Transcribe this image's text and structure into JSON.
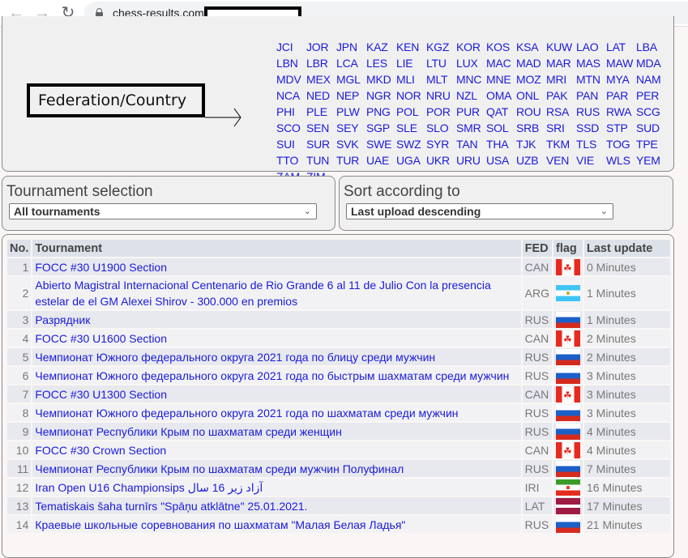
{
  "browser": {
    "url": "chess-results.com/",
    "back_icon": "arrow-left-icon",
    "forward_icon": "arrow-right-icon",
    "reload_icon": "reload-icon"
  },
  "annotation": {
    "label": "Federation/Country"
  },
  "federations": [
    "JCI",
    "JOR",
    "JPN",
    "KAZ",
    "KEN",
    "KGZ",
    "KOR",
    "KOS",
    "KSA",
    "KUW",
    "LAO",
    "LAT",
    "LBA",
    "LBN",
    "LBR",
    "LCA",
    "LES",
    "LIE",
    "LTU",
    "LUX",
    "MAC",
    "MAD",
    "MAR",
    "MAS",
    "MAW",
    "MDA",
    "MDV",
    "MEX",
    "MGL",
    "MKD",
    "MLI",
    "MLT",
    "MNC",
    "MNE",
    "MOZ",
    "MRI",
    "MTN",
    "MYA",
    "NAM",
    "NCA",
    "NED",
    "NEP",
    "NGR",
    "NOR",
    "NRU",
    "NZL",
    "OMA",
    "ONL",
    "PAK",
    "PAN",
    "PAR",
    "PER",
    "PHI",
    "PLE",
    "PLW",
    "PNG",
    "POL",
    "POR",
    "PUR",
    "QAT",
    "ROU",
    "RSA",
    "RUS",
    "RWA",
    "SCG",
    "SCO",
    "SEN",
    "SEY",
    "SGP",
    "SLE",
    "SLO",
    "SMR",
    "SOL",
    "SRB",
    "SRI",
    "SSD",
    "STP",
    "SUD",
    "SUI",
    "SUR",
    "SVK",
    "SWE",
    "SWZ",
    "SYR",
    "TAN",
    "THA",
    "TJK",
    "TKM",
    "TLS",
    "TOG",
    "TPE",
    "TTO",
    "TUN",
    "TUR",
    "UAE",
    "UGA",
    "UKR",
    "URU",
    "USA",
    "UZB",
    "VEN",
    "VIE",
    "WLS",
    "YEM",
    "ZAM",
    "ZIM"
  ],
  "tournament_selection": {
    "title": "Tournament selection",
    "selected": "All tournaments"
  },
  "sort_selection": {
    "title": "Sort according to",
    "selected": "Last upload descending"
  },
  "table": {
    "headers": {
      "no": "No.",
      "tournament": "Tournament",
      "fed": "FED",
      "flag": "flag",
      "last_update": "Last update"
    },
    "rows": [
      {
        "no": "1",
        "name": "FOCC #30 U1900 Section",
        "fed": "CAN",
        "flag": "can",
        "updated": "0 Minutes"
      },
      {
        "no": "2",
        "name": "Abierto Magistral Internacional Centenario de Rio Grande 6 al 11 de Julio Con la presencia estelar de el GM Alexei Shirov - 300.000 en premios",
        "fed": "ARG",
        "flag": "arg",
        "updated": "1 Minutes"
      },
      {
        "no": "3",
        "name": "Разрядник",
        "fed": "RUS",
        "flag": "rus",
        "updated": "1 Minutes"
      },
      {
        "no": "4",
        "name": "FOCC #30 U1600 Section",
        "fed": "CAN",
        "flag": "can",
        "updated": "2 Minutes"
      },
      {
        "no": "5",
        "name": "Чемпионат Южного федерального округа 2021 года по блицу среди мужчин",
        "fed": "RUS",
        "flag": "rus",
        "updated": "2 Minutes"
      },
      {
        "no": "6",
        "name": "Чемпионат Южного федерального округа 2021 года по быстрым шахматам среди мужчин",
        "fed": "RUS",
        "flag": "rus",
        "updated": "3 Minutes"
      },
      {
        "no": "7",
        "name": "FOCC #30 U1300 Section",
        "fed": "CAN",
        "flag": "can",
        "updated": "3 Minutes"
      },
      {
        "no": "8",
        "name": "Чемпионат Южного федерального округа 2021 года по шахматам среди мужчин",
        "fed": "RUS",
        "flag": "rus",
        "updated": "3 Minutes"
      },
      {
        "no": "9",
        "name": "Чемпионат Республики Крым по шахматам среди женщин",
        "fed": "RUS",
        "flag": "rus",
        "updated": "4 Minutes"
      },
      {
        "no": "10",
        "name": "FOCC #30 Crown Section",
        "fed": "CAN",
        "flag": "can",
        "updated": "4 Minutes"
      },
      {
        "no": "11",
        "name": "Чемпионат Республики Крым по шахматам среди мужчин Полуфинал",
        "fed": "RUS",
        "flag": "rus",
        "updated": "7 Minutes"
      },
      {
        "no": "12",
        "name": "Iran Open U16 Championsips آزاد زیر 16 سال",
        "fed": "IRI",
        "flag": "iri",
        "updated": "16 Minutes"
      },
      {
        "no": "13",
        "name": "Tematiskais šaha turnīrs \"Spāņu atklātne\" 25.01.2021.",
        "fed": "LAT",
        "flag": "lat",
        "updated": "17 Minutes"
      },
      {
        "no": "14",
        "name": "Краевые школьные соревнования по шахматам \"Малая Белая Ладья\"",
        "fed": "RUS",
        "flag": "rus",
        "updated": "21 Minutes"
      }
    ]
  }
}
